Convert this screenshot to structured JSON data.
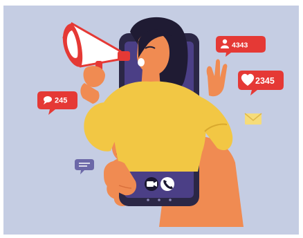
{
  "badges": {
    "followers_count": "4343",
    "likes_count": "2345",
    "comments_count": "245"
  },
  "icons": {
    "followers": "person-icon",
    "likes": "heart-icon",
    "comments": "speech-bubble-icon",
    "mail": "envelope-icon",
    "chat": "chat-icon",
    "video_call": "video-camera-icon",
    "phone_call": "phone-icon",
    "megaphone": "megaphone-icon"
  },
  "colors": {
    "background": "#c5cde3",
    "badge_red": "#e53935",
    "phone_frame": "#2b2746",
    "phone_screen": "#4b3f86",
    "sweater": "#f2c744",
    "skin": "#f08b52",
    "hair": "#1f1b33",
    "mail_yellow": "#f6dc7a",
    "chat_purple": "#6c68a8"
  }
}
